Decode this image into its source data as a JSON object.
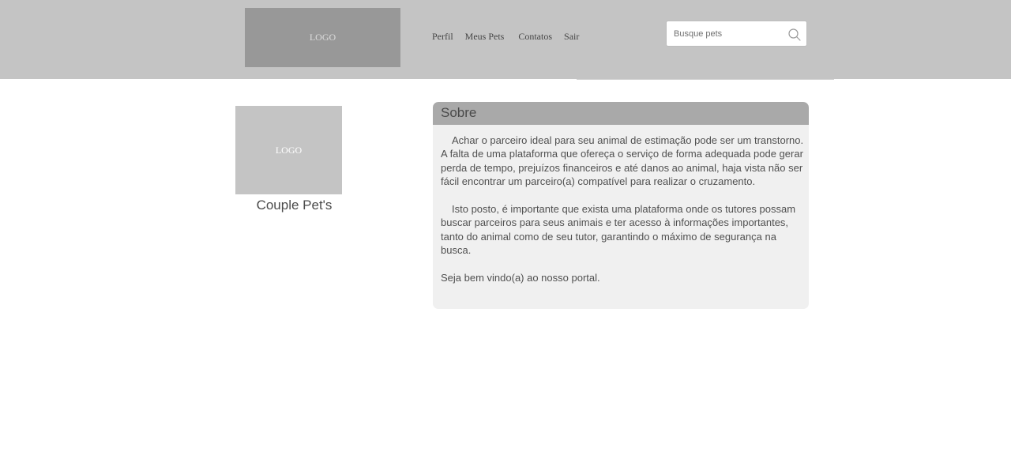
{
  "header": {
    "logo_text": "LOGO",
    "nav": {
      "perfil": "Perfil",
      "meus_pets": "Meus Pets",
      "contatos": "Contatos",
      "sair": "Sair"
    },
    "search": {
      "placeholder": "Busque pets",
      "value": "",
      "icon": "search-icon"
    }
  },
  "profile": {
    "logo_text": "LOGO",
    "name": "Couple Pet's"
  },
  "about": {
    "title": "Sobre",
    "paragraphs": [
      "Achar o parceiro ideal para seu animal de estimação pode ser um transtorno. A falta de uma plataforma que ofereça o serviço de forma adequada pode gerar perda de tempo, prejuízos financeiros e até danos ao animal, haja vista não ser fácil encontrar um parceiro(a) compatível para realizar o cruzamento.",
      "Isto posto, é importante que exista uma plataforma onde os tutores possam buscar parceiros para seus animais e ter acesso à informações importantes, tanto do animal como de seu tutor, garantindo o máximo de segurança na busca.",
      "Seja bem vindo(a) ao nosso portal."
    ]
  },
  "colors": {
    "header_bg": "#c4c4c4",
    "logo_header_bg": "#989898",
    "profile_logo_bg": "#c4c4c4",
    "about_title_bg": "#a9a9a9",
    "about_card_bg": "#f0f0f0"
  }
}
